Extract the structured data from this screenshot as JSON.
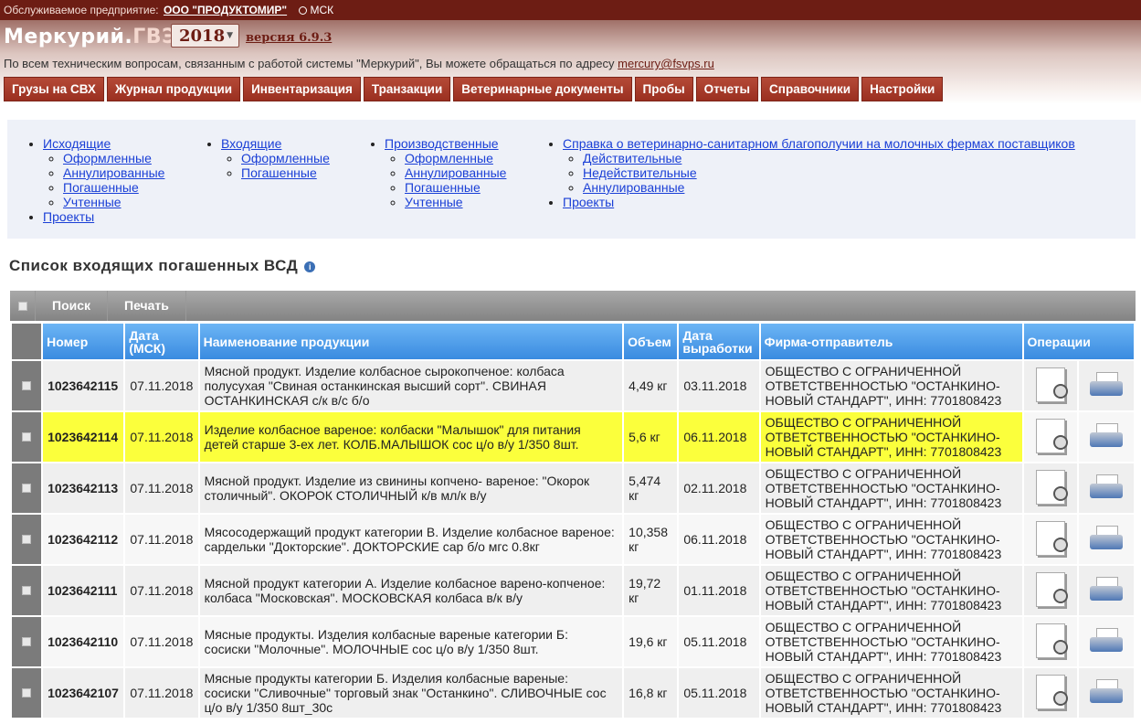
{
  "topbar": {
    "enterprise_label": "Обслуживаемое предприятие:",
    "enterprise_name": "ООО \"ПРОДУКТОМИР\"",
    "timezone": "МСК"
  },
  "header": {
    "logo_main": "Меркурий.",
    "logo_sub": "ГВЭ",
    "year": "2018",
    "version": "версия 6.9.3",
    "support_text": "По всем техническим вопросам, связанным с работой системы \"Меркурий\", Вы можете обращаться по адресу",
    "support_email": "mercury@fsvps.ru"
  },
  "menu": [
    "Грузы на СВХ",
    "Журнал продукции",
    "Инвентаризация",
    "Транзакции",
    "Ветеринарные документы",
    "Пробы",
    "Отчеты",
    "Справочники",
    "Настройки"
  ],
  "filters": {
    "outgoing": {
      "label": "Исходящие",
      "items": [
        "Оформленные",
        "Аннулированные",
        "Погашенные",
        "Учтенные"
      ]
    },
    "projects1": "Проекты",
    "incoming": {
      "label": "Входящие",
      "items": [
        "Оформленные",
        "Погашенные"
      ]
    },
    "production": {
      "label": "Производственные",
      "items": [
        "Оформленные",
        "Аннулированные",
        "Погашенные",
        "Учтенные"
      ]
    },
    "reference": {
      "label": "Справка о ветеринарно-санитарном благополучии на молочных фермах поставщиков",
      "items": [
        "Действительные",
        "Недействительные",
        "Аннулированные"
      ]
    },
    "projects2": "Проекты"
  },
  "page_title": "Список входящих погашенных ВСД",
  "toolbar": {
    "search": "Поиск",
    "print": "Печать"
  },
  "table": {
    "headers": [
      "Номер",
      "Дата (МСК)",
      "Наименование продукции",
      "Объем",
      "Дата выработки",
      "Фирма-отправитель",
      "Операции"
    ],
    "rows": [
      {
        "num": "1023642115",
        "date": "07.11.2018",
        "name": "Мясной продукт. Изделие колбасное сырокопченое: колбаса полусухая \"Свиная останкинская высший сорт\". СВИНАЯ ОСТАНКИНСКАЯ с/к в/с б/о",
        "vol": "4,49 кг",
        "prod": "03.11.2018",
        "firm": "ОБЩЕСТВО С ОГРАНИЧЕННОЙ ОТВЕТСТВЕННОСТЬЮ \"ОСТАНКИНО-НОВЫЙ СТАНДАРТ\", ИНН: 7701808423"
      },
      {
        "num": "1023642114",
        "date": "07.11.2018",
        "name": "Изделие колбасное вареное: колбаски \"Малышок\" для питания детей старше 3-ех лет. КОЛБ.МАЛЫШОК сос ц/о в/у 1/350 8шт.",
        "vol": "5,6 кг",
        "prod": "06.11.2018",
        "firm": "ОБЩЕСТВО С ОГРАНИЧЕННОЙ ОТВЕТСТВЕННОСТЬЮ \"ОСТАНКИНО-НОВЫЙ СТАНДАРТ\", ИНН: 7701808423"
      },
      {
        "num": "1023642113",
        "date": "07.11.2018",
        "name": "Мясной продукт. Изделие из свинины копчено- вареное: \"Окорок столичный\". ОКОРОК СТОЛИЧНЫЙ к/в мл/к в/у",
        "vol": "5,474 кг",
        "prod": "02.11.2018",
        "firm": "ОБЩЕСТВО С ОГРАНИЧЕННОЙ ОТВЕТСТВЕННОСТЬЮ \"ОСТАНКИНО-НОВЫЙ СТАНДАРТ\", ИНН: 7701808423"
      },
      {
        "num": "1023642112",
        "date": "07.11.2018",
        "name": "Мясосодержащий продукт категории В. Изделие колбасное вареное: сардельки \"Докторские\". ДОКТОРСКИЕ сар б/о мгс 0.8кг",
        "vol": "10,358 кг",
        "prod": "06.11.2018",
        "firm": "ОБЩЕСТВО С ОГРАНИЧЕННОЙ ОТВЕТСТВЕННОСТЬЮ \"ОСТАНКИНО-НОВЫЙ СТАНДАРТ\", ИНН: 7701808423"
      },
      {
        "num": "1023642111",
        "date": "07.11.2018",
        "name": "Мясной продукт категории А. Изделие колбасное варено-копченое: колбаса \"Московская\". МОСКОВСКАЯ колбаса в/к в/у",
        "vol": "19,72 кг",
        "prod": "01.11.2018",
        "firm": "ОБЩЕСТВО С ОГРАНИЧЕННОЙ ОТВЕТСТВЕННОСТЬЮ \"ОСТАНКИНО-НОВЫЙ СТАНДАРТ\", ИНН: 7701808423"
      },
      {
        "num": "1023642110",
        "date": "07.11.2018",
        "name": "Мясные продукты. Изделия колбасные вареные категории Б: сосиски \"Молочные\". МОЛОЧНЫЕ сос ц/о в/у 1/350 8шт.",
        "vol": "19,6 кг",
        "prod": "05.11.2018",
        "firm": "ОБЩЕСТВО С ОГРАНИЧЕННОЙ ОТВЕТСТВЕННОСТЬЮ \"ОСТАНКИНО-НОВЫЙ СТАНДАРТ\", ИНН: 7701808423"
      },
      {
        "num": "1023642107",
        "date": "07.11.2018",
        "name": "Мясные продукты категории Б. Изделия колбасные вареные: сосиски \"Сливочные\" торговый знак \"Останкино\". СЛИВОЧНЫЕ сос ц/о в/у 1/350 8шт_30с",
        "vol": "16,8 кг",
        "prod": "05.11.2018",
        "firm": "ОБЩЕСТВО С ОГРАНИЧЕННОЙ ОТВЕТСТВЕННОСТЬЮ \"ОСТАНКИНО-НОВЫЙ СТАНДАРТ\", ИНН: 7701808423"
      }
    ]
  }
}
